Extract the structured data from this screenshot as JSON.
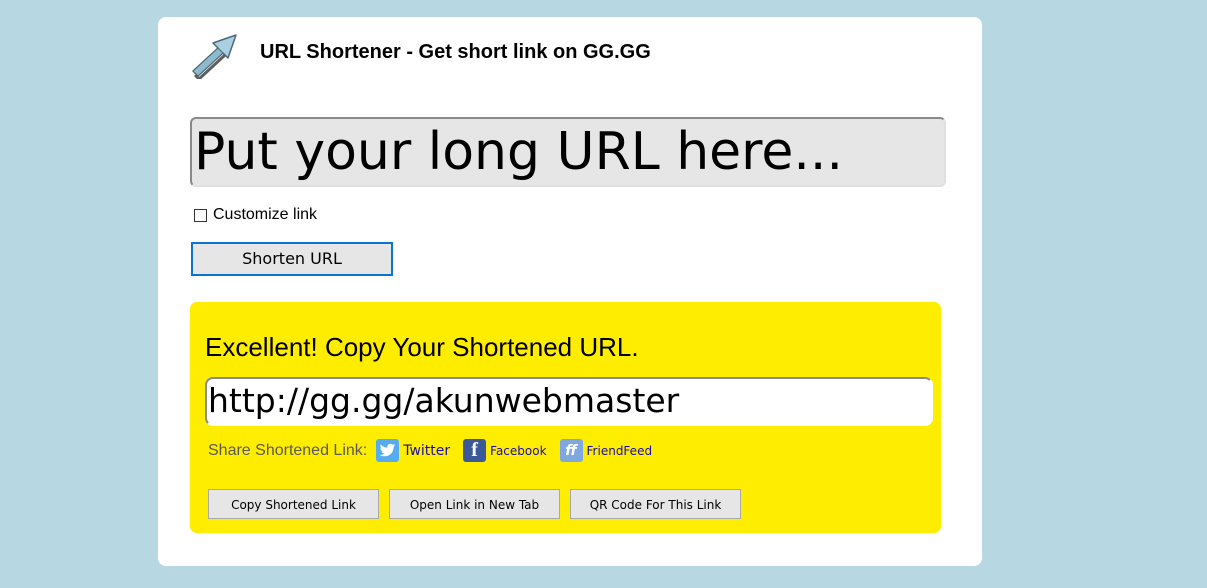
{
  "header": {
    "title": "URL Shortener - Get short link on GG.GG",
    "logo_icon": "arrow-icon"
  },
  "form": {
    "url_placeholder": "Put your long URL here...",
    "customize_label": "Customize link",
    "customize_checked": false,
    "shorten_label": "Shorten URL"
  },
  "result": {
    "title": "Excellent! Copy Your Shortened URL.",
    "short_url": "http://gg.gg/akunwebmaster",
    "share_label": "Share Shortened Link:",
    "share_links": [
      {
        "label": "Twitter",
        "icon": "twitter-icon",
        "color": "#55acee"
      },
      {
        "label": "Facebook",
        "icon": "facebook-icon",
        "color": "#3b5998"
      },
      {
        "label": "FriendFeed",
        "icon": "friendfeed-icon",
        "color": "#80a8e0"
      }
    ],
    "buttons": {
      "copy": "Copy Shortened Link",
      "open": "Open Link in New Tab",
      "qr": "QR Code For This Link"
    }
  },
  "colors": {
    "page_background": "#b7d7e3",
    "result_background": "#ffed00",
    "button_focus_border": "#0a74d0"
  }
}
